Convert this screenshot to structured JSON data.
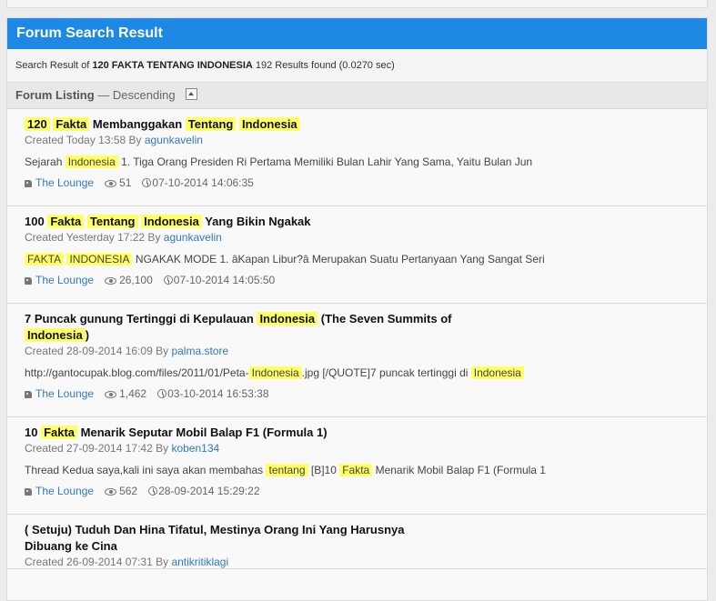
{
  "panel": {
    "title": "Forum Search Result"
  },
  "summary": {
    "prefix": "Search Result of",
    "query": "120 FAKTA TENTANG INDONESIA",
    "count_text": "192 Results found (0.0270 sec)"
  },
  "listing": {
    "title": "Forum Listing",
    "sort": "— Descending"
  },
  "results": [
    {
      "title_parts": [
        {
          "t": "120",
          "h": true
        },
        {
          "t": " ",
          "h": false
        },
        {
          "t": "Fakta",
          "h": true
        },
        {
          "t": " Membanggakan ",
          "h": false
        },
        {
          "t": "Tentang",
          "h": true
        },
        {
          "t": " ",
          "h": false
        },
        {
          "t": "Indonesia",
          "h": true
        }
      ],
      "created_label": "Created Today 13:58 By",
      "author": "agunkavelin",
      "snippet_parts": [
        {
          "t": "Sejarah ",
          "h": false
        },
        {
          "t": "Indonesia",
          "h": true
        },
        {
          "t": " 1. Tiga Orang Presiden Ri Pertama Memiliki Bulan Lahir Yang Sama, Yaitu Bulan Jun",
          "h": false
        }
      ],
      "forum": "The Lounge",
      "views": "51",
      "last_post": "07-10-2014 14:06:35"
    },
    {
      "title_parts": [
        {
          "t": "100 ",
          "h": false
        },
        {
          "t": "Fakta",
          "h": true
        },
        {
          "t": " ",
          "h": false
        },
        {
          "t": "Tentang",
          "h": true
        },
        {
          "t": " ",
          "h": false
        },
        {
          "t": "Indonesia",
          "h": true
        },
        {
          "t": " Yang Bikin Ngakak",
          "h": false
        }
      ],
      "created_label": "Created Yesterday 17:22 By",
      "author": "agunkavelin",
      "snippet_parts": [
        {
          "t": "FAKTA",
          "h": true
        },
        {
          "t": " ",
          "h": false
        },
        {
          "t": "INDONESIA",
          "h": true
        },
        {
          "t": " NGAKAK MODE 1. âKapan Libur?â Merupakan Suatu Pertanyaan Yang Sangat Seri",
          "h": false
        }
      ],
      "forum": "The Lounge",
      "views": "26,100",
      "last_post": "07-10-2014 14:05:50"
    },
    {
      "title_parts": [
        {
          "t": "7 Puncak gunung Tertinggi di Kepulauan ",
          "h": false
        },
        {
          "t": "Indonesia",
          "h": true
        },
        {
          "t": " (The Seven Summits of ",
          "h": false
        },
        {
          "t": "Indonesia",
          "h": true
        },
        {
          "t": ")",
          "h": false
        }
      ],
      "created_label": "Created 28-09-2014 16:09 By",
      "author": "palma.store",
      "snippet_parts": [
        {
          "t": "http://gantocupak.blog.com/files/2011/01/Peta-",
          "h": false
        },
        {
          "t": "Indonesia",
          "h": true
        },
        {
          "t": ".jpg [/QUOTE]7 puncak tertinggi di ",
          "h": false
        },
        {
          "t": "Indonesia",
          "h": true
        }
      ],
      "forum": "The Lounge",
      "views": "1,462",
      "last_post": "03-10-2014 16:53:38"
    },
    {
      "title_parts": [
        {
          "t": "10 ",
          "h": false
        },
        {
          "t": "Fakta",
          "h": true
        },
        {
          "t": " Menarik Seputar Mobil Balap F1 (Formula 1)",
          "h": false
        }
      ],
      "created_label": "Created 27-09-2014 17:42 By",
      "author": "koben134",
      "snippet_parts": [
        {
          "t": "Thread Kedua saya,kali ini saya akan membahas ",
          "h": false
        },
        {
          "t": "tentang",
          "h": true
        },
        {
          "t": " [B]10 ",
          "h": false
        },
        {
          "t": "Fakta",
          "h": true
        },
        {
          "t": " Menarik Mobil Balap F1 (Formula 1",
          "h": false
        }
      ],
      "forum": "The Lounge",
      "views": "562",
      "last_post": "28-09-2014 15:29:22"
    },
    {
      "title_parts": [
        {
          "t": "( Setuju) Tuduh Dan Hina Tifatul, Mestinya Orang Ini Yang Harusnya Dibuang ke Cina",
          "h": false
        }
      ],
      "created_label": "Created 26-09-2014 07:31 By",
      "author": "antikritiklagi",
      "snippet_parts": [],
      "forum": "",
      "views": "",
      "last_post": ""
    }
  ],
  "icons": {
    "forum": "tag-icon",
    "views": "eye-icon",
    "time": "clock-icon",
    "collapse": "collapse-up-icon"
  },
  "colors": {
    "header": "#1e88e5",
    "highlight": "#ffff66",
    "link": "#2f79c6"
  }
}
